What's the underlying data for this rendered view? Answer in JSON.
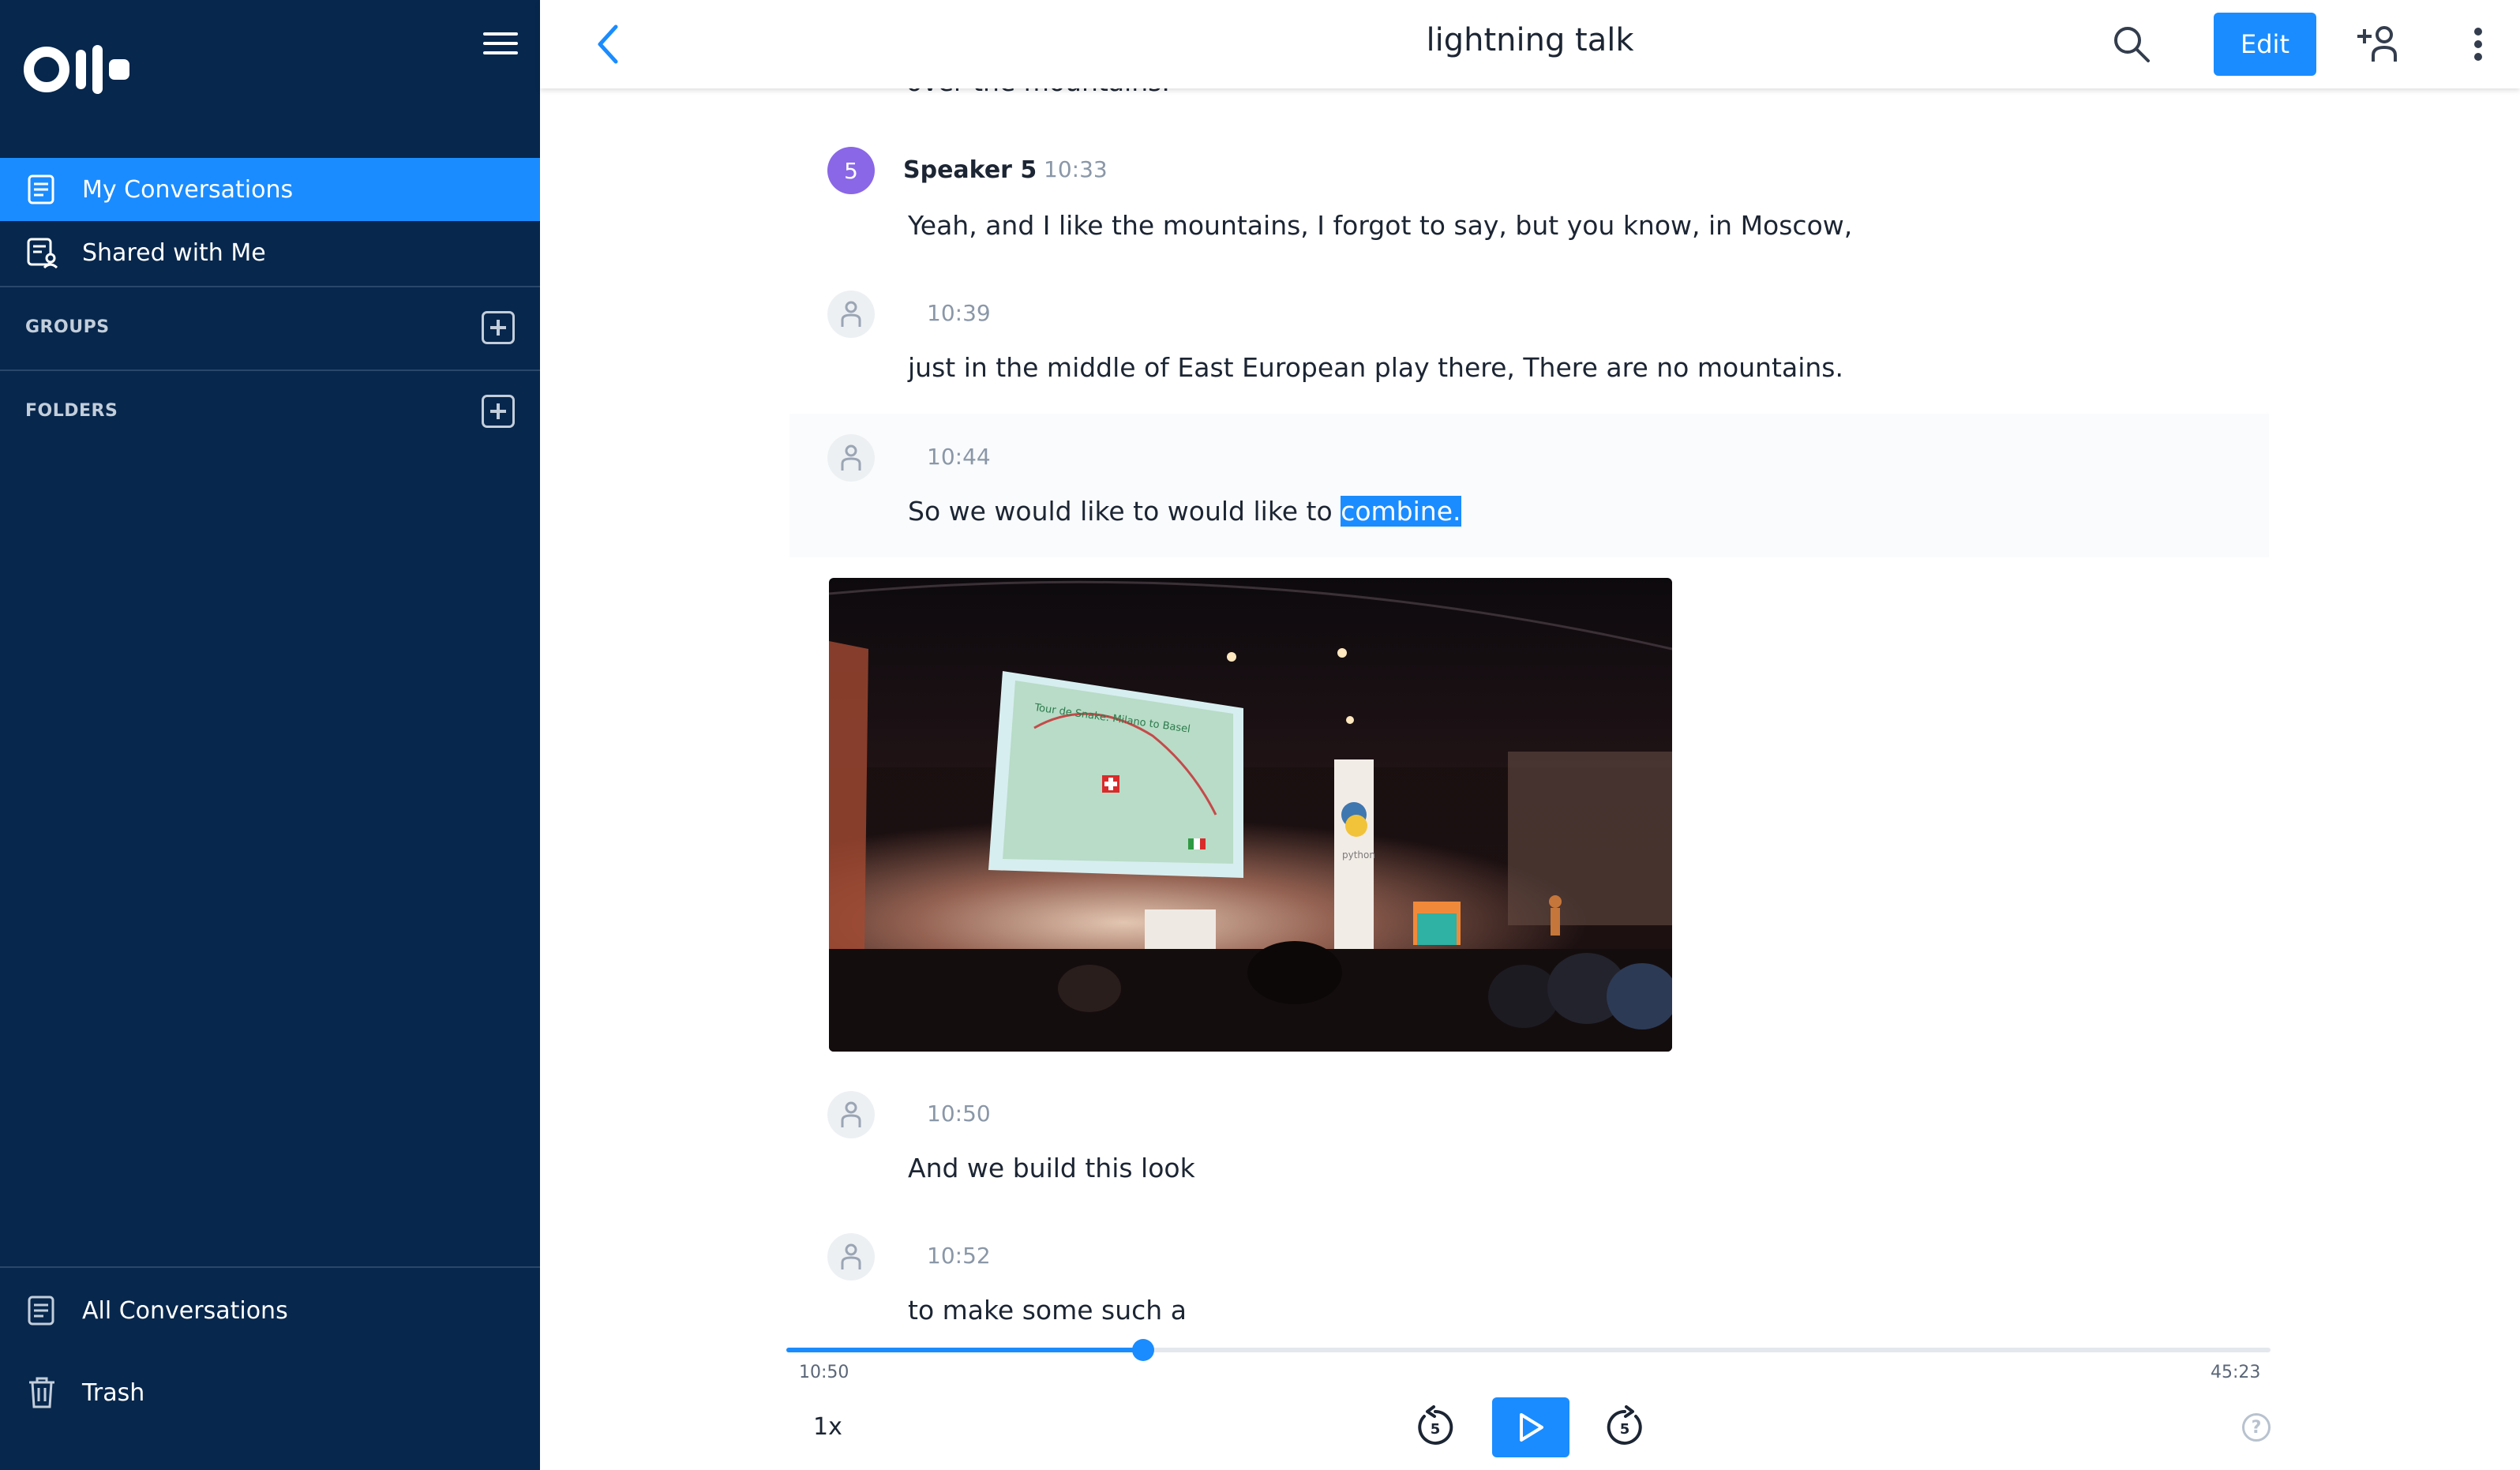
{
  "app": {
    "logo": "Otter"
  },
  "sidebar": {
    "nav": [
      {
        "label": "My Conversations",
        "icon": "conversations-icon",
        "active": true
      },
      {
        "label": "Shared with Me",
        "icon": "shared-icon",
        "active": false
      }
    ],
    "groups_label": "GROUPS",
    "folders_label": "FOLDERS",
    "bottom": [
      {
        "label": "All Conversations",
        "icon": "all-conversations-icon"
      },
      {
        "label": "Trash",
        "icon": "trash-icon"
      }
    ]
  },
  "header": {
    "title": "lightning talk",
    "edit_label": "Edit"
  },
  "transcript": {
    "cut_off_text": "over the mountains.",
    "entries": [
      {
        "avatar": "5",
        "speaker": "Speaker 5",
        "time": "10:33",
        "text": "Yeah, and I like the mountains, I forgot to say, but you know, in Moscow,"
      },
      {
        "speaker": "",
        "time": "10:39",
        "text": "just in the middle of East European play there, There are no mountains."
      },
      {
        "speaker": "",
        "time": "10:44",
        "text_before": "So we would like to would like to ",
        "text_selected": "combine."
      },
      {
        "speaker": "",
        "time": "10:50",
        "text": "And we build this look"
      },
      {
        "speaker": "",
        "time": "10:52",
        "text": "to make some such a"
      }
    ],
    "photo": {
      "slide_title": "Tour de Snake: Milano to Basel",
      "banner_text": "python"
    }
  },
  "player": {
    "current_time": "10:50",
    "total_time": "45:23",
    "progress": 0.2405,
    "speed": "1x",
    "skip_back": "5",
    "skip_forward": "5",
    "help": "?"
  },
  "colors": {
    "sidebar_bg": "#07274d",
    "accent": "#1a8cff",
    "speaker5_avatar": "#8a67e6"
  }
}
